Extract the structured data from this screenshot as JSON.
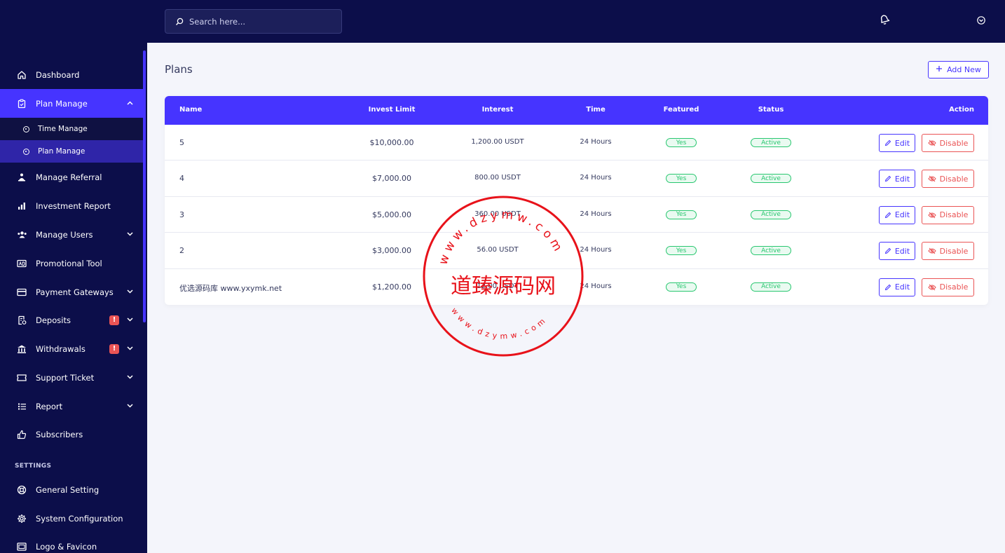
{
  "search": {
    "placeholder": "Search here..."
  },
  "icons": {
    "bell": "bell-icon",
    "chevron": "chevron-down-icon"
  },
  "colors": {
    "sidebar_bg": "#0c0e4a",
    "accent": "#4634ff",
    "success": "#28c76f",
    "danger": "#ea5455"
  },
  "sidebar": {
    "dashboard": "Dashboard",
    "plan_manage": "Plan Manage",
    "sub_time_manage": "Time Manage",
    "sub_plan_manage": "Plan Manage",
    "manage_referral": "Manage Referral",
    "investment_report": "Investment Report",
    "manage_users": "Manage Users",
    "promotional_tool": "Promotional Tool",
    "payment_gateways": "Payment Gateways",
    "deposits": "Deposits",
    "withdrawals": "Withdrawals",
    "support_ticket": "Support Ticket",
    "report": "Report",
    "subscribers": "Subscribers",
    "settings_title": "SETTINGS",
    "general_setting": "General Setting",
    "system_configuration": "System Configuration",
    "logo_favicon": "Logo & Favicon",
    "badge": "!"
  },
  "page": {
    "title": "Plans",
    "add_new": "Add New"
  },
  "table": {
    "headers": {
      "name": "Name",
      "invest_limit": "Invest Limit",
      "interest": "Interest",
      "time": "Time",
      "featured": "Featured",
      "status": "Status",
      "action": "Action"
    },
    "edit_label": "Edit",
    "disable_label": "Disable",
    "rows": [
      {
        "name": "5",
        "invest_limit": "$10,000.00",
        "interest": "1,200.00 USDT",
        "time": "24 Hours",
        "featured": "Yes",
        "status": "Active"
      },
      {
        "name": "4",
        "invest_limit": "$7,000.00",
        "interest": "800.00 USDT",
        "time": "24 Hours",
        "featured": "Yes",
        "status": "Active"
      },
      {
        "name": "3",
        "invest_limit": "$5,000.00",
        "interest": "360.00 USDT",
        "time": "24 Hours",
        "featured": "Yes",
        "status": "Active"
      },
      {
        "name": "2",
        "invest_limit": "$3,000.00",
        "interest": "56.00 USDT",
        "time": "24 Hours",
        "featured": "Yes",
        "status": "Active"
      },
      {
        "name": "优选源码库 www.yxymk.net",
        "invest_limit": "$1,200.00",
        "interest": "12.00 USDT",
        "time": "24 Hours",
        "featured": "Yes",
        "status": "Active"
      }
    ]
  },
  "watermark": {
    "center_text": "道臻源码网",
    "ring_text": "www.dzymw.com"
  }
}
